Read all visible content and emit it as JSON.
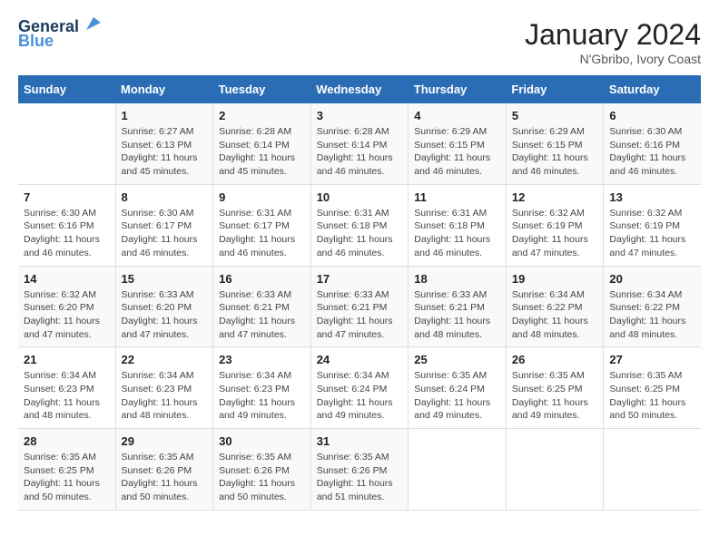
{
  "header": {
    "logo_line1": "General",
    "logo_line2": "Blue",
    "month_title": "January 2024",
    "location": "N'Gbribo, Ivory Coast"
  },
  "columns": [
    "Sunday",
    "Monday",
    "Tuesday",
    "Wednesday",
    "Thursday",
    "Friday",
    "Saturday"
  ],
  "weeks": [
    [
      {
        "day": "",
        "info": ""
      },
      {
        "day": "1",
        "info": "Sunrise: 6:27 AM\nSunset: 6:13 PM\nDaylight: 11 hours\nand 45 minutes."
      },
      {
        "day": "2",
        "info": "Sunrise: 6:28 AM\nSunset: 6:14 PM\nDaylight: 11 hours\nand 45 minutes."
      },
      {
        "day": "3",
        "info": "Sunrise: 6:28 AM\nSunset: 6:14 PM\nDaylight: 11 hours\nand 46 minutes."
      },
      {
        "day": "4",
        "info": "Sunrise: 6:29 AM\nSunset: 6:15 PM\nDaylight: 11 hours\nand 46 minutes."
      },
      {
        "day": "5",
        "info": "Sunrise: 6:29 AM\nSunset: 6:15 PM\nDaylight: 11 hours\nand 46 minutes."
      },
      {
        "day": "6",
        "info": "Sunrise: 6:30 AM\nSunset: 6:16 PM\nDaylight: 11 hours\nand 46 minutes."
      }
    ],
    [
      {
        "day": "7",
        "info": "Sunrise: 6:30 AM\nSunset: 6:16 PM\nDaylight: 11 hours\nand 46 minutes."
      },
      {
        "day": "8",
        "info": "Sunrise: 6:30 AM\nSunset: 6:17 PM\nDaylight: 11 hours\nand 46 minutes."
      },
      {
        "day": "9",
        "info": "Sunrise: 6:31 AM\nSunset: 6:17 PM\nDaylight: 11 hours\nand 46 minutes."
      },
      {
        "day": "10",
        "info": "Sunrise: 6:31 AM\nSunset: 6:18 PM\nDaylight: 11 hours\nand 46 minutes."
      },
      {
        "day": "11",
        "info": "Sunrise: 6:31 AM\nSunset: 6:18 PM\nDaylight: 11 hours\nand 46 minutes."
      },
      {
        "day": "12",
        "info": "Sunrise: 6:32 AM\nSunset: 6:19 PM\nDaylight: 11 hours\nand 47 minutes."
      },
      {
        "day": "13",
        "info": "Sunrise: 6:32 AM\nSunset: 6:19 PM\nDaylight: 11 hours\nand 47 minutes."
      }
    ],
    [
      {
        "day": "14",
        "info": "Sunrise: 6:32 AM\nSunset: 6:20 PM\nDaylight: 11 hours\nand 47 minutes."
      },
      {
        "day": "15",
        "info": "Sunrise: 6:33 AM\nSunset: 6:20 PM\nDaylight: 11 hours\nand 47 minutes."
      },
      {
        "day": "16",
        "info": "Sunrise: 6:33 AM\nSunset: 6:21 PM\nDaylight: 11 hours\nand 47 minutes."
      },
      {
        "day": "17",
        "info": "Sunrise: 6:33 AM\nSunset: 6:21 PM\nDaylight: 11 hours\nand 47 minutes."
      },
      {
        "day": "18",
        "info": "Sunrise: 6:33 AM\nSunset: 6:21 PM\nDaylight: 11 hours\nand 48 minutes."
      },
      {
        "day": "19",
        "info": "Sunrise: 6:34 AM\nSunset: 6:22 PM\nDaylight: 11 hours\nand 48 minutes."
      },
      {
        "day": "20",
        "info": "Sunrise: 6:34 AM\nSunset: 6:22 PM\nDaylight: 11 hours\nand 48 minutes."
      }
    ],
    [
      {
        "day": "21",
        "info": "Sunrise: 6:34 AM\nSunset: 6:23 PM\nDaylight: 11 hours\nand 48 minutes."
      },
      {
        "day": "22",
        "info": "Sunrise: 6:34 AM\nSunset: 6:23 PM\nDaylight: 11 hours\nand 48 minutes."
      },
      {
        "day": "23",
        "info": "Sunrise: 6:34 AM\nSunset: 6:23 PM\nDaylight: 11 hours\nand 49 minutes."
      },
      {
        "day": "24",
        "info": "Sunrise: 6:34 AM\nSunset: 6:24 PM\nDaylight: 11 hours\nand 49 minutes."
      },
      {
        "day": "25",
        "info": "Sunrise: 6:35 AM\nSunset: 6:24 PM\nDaylight: 11 hours\nand 49 minutes."
      },
      {
        "day": "26",
        "info": "Sunrise: 6:35 AM\nSunset: 6:25 PM\nDaylight: 11 hours\nand 49 minutes."
      },
      {
        "day": "27",
        "info": "Sunrise: 6:35 AM\nSunset: 6:25 PM\nDaylight: 11 hours\nand 50 minutes."
      }
    ],
    [
      {
        "day": "28",
        "info": "Sunrise: 6:35 AM\nSunset: 6:25 PM\nDaylight: 11 hours\nand 50 minutes."
      },
      {
        "day": "29",
        "info": "Sunrise: 6:35 AM\nSunset: 6:26 PM\nDaylight: 11 hours\nand 50 minutes."
      },
      {
        "day": "30",
        "info": "Sunrise: 6:35 AM\nSunset: 6:26 PM\nDaylight: 11 hours\nand 50 minutes."
      },
      {
        "day": "31",
        "info": "Sunrise: 6:35 AM\nSunset: 6:26 PM\nDaylight: 11 hours\nand 51 minutes."
      },
      {
        "day": "",
        "info": ""
      },
      {
        "day": "",
        "info": ""
      },
      {
        "day": "",
        "info": ""
      }
    ]
  ]
}
